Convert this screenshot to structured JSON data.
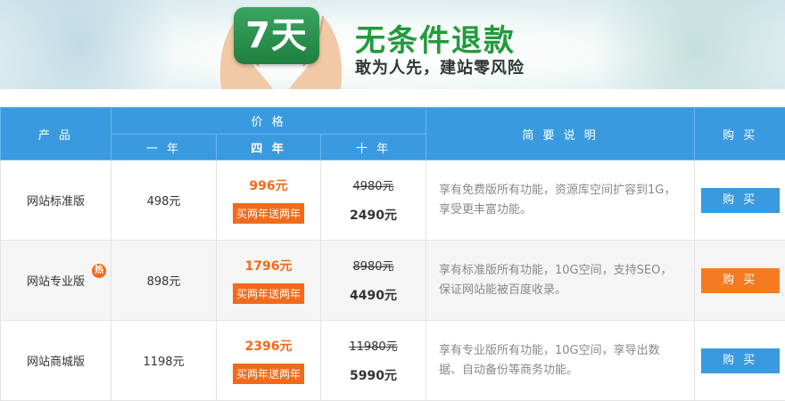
{
  "banner": {
    "days": "7天",
    "title": "无条件退款",
    "subtitle": "敢为人先，建站零风险"
  },
  "colors": {
    "header_blue": "#3a9ae0",
    "accent_orange": "#f26a1b",
    "banner_green": "#239a3c"
  },
  "table": {
    "headers": {
      "product": "产 品",
      "price": "价 格",
      "year1": "一 年",
      "year4": "四 年",
      "year10": "十 年",
      "description": "简 要 说 明",
      "buy": "购 买"
    },
    "rows": [
      {
        "name": "网站标准版",
        "one_year": "498元",
        "four_year": "996元",
        "four_year_promo": "买两年送两年",
        "ten_year_original": "4980元",
        "ten_year": "2490元",
        "description": "享有免费版所有功能，资源库空间扩容到1G，享受更丰富功能。",
        "button": "购 买",
        "button_color": "blue"
      },
      {
        "name": "网站专业版",
        "hot_badge": "热",
        "one_year": "898元",
        "four_year": "1796元",
        "four_year_promo": "买两年送两年",
        "ten_year_original": "8980元",
        "ten_year": "4490元",
        "description": "享有标准版所有功能，10G空间，支持SEO，保证网站能被百度收录。",
        "button": "购 买",
        "button_color": "orange"
      },
      {
        "name": "网站商城版",
        "one_year": "1198元",
        "four_year": "2396元",
        "four_year_promo": "买两年送两年",
        "ten_year_original": "11980元",
        "ten_year": "5990元",
        "description": "享有专业版所有功能，10G空间，享导出数据、自动备份等商务功能。",
        "button": "购 买",
        "button_color": "blue"
      }
    ]
  }
}
